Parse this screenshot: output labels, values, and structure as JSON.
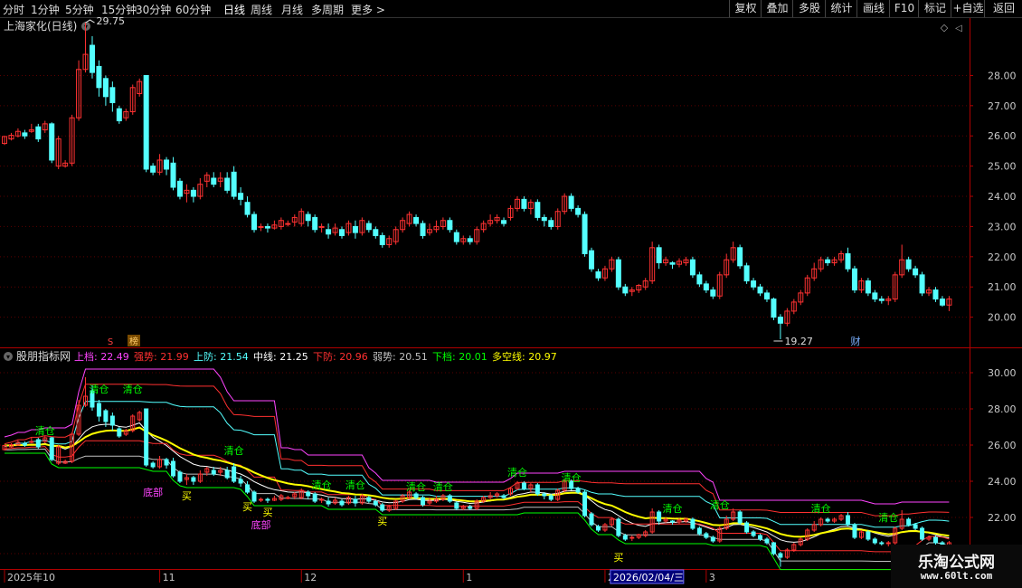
{
  "toolbar": {
    "periods": [
      "分时",
      "1分钟",
      "5分钟",
      "15分钟",
      "30分钟",
      "60分钟",
      "日线",
      "周线",
      "月线",
      "多周期",
      "更多"
    ],
    "more_arrow": ">",
    "buttons": [
      "复权",
      "叠加",
      "多股",
      "统计",
      "画线",
      "F10",
      "标记",
      "+自选",
      "返回"
    ]
  },
  "colors": {
    "up": "#ff3232",
    "down": "#54ffff",
    "axis": "#b00000",
    "upper": "#ff44ff",
    "strong": "#ff3030",
    "upper_def": "#54ffff",
    "mid": "#ffffff",
    "lower_def": "#ff3030",
    "weak": "#c0c0c0",
    "lower": "#00ff00",
    "bullbear": "#ffff00",
    "qingcang": "#00ff00",
    "dibu": "#ff44ff",
    "mai": "#ffff00"
  },
  "chart_data": {
    "type": "candlestick",
    "title": "上海家化(日线)",
    "main_yticks": [
      "20.00",
      "21.00",
      "22.00",
      "23.00",
      "24.00",
      "25.00",
      "26.00",
      "27.00",
      "28.00"
    ],
    "main_ylim": [
      19.0,
      29.9
    ],
    "max_label": "29.75",
    "min_label": "19.27",
    "markers": {
      "s": "S",
      "bang": "榜",
      "cai": "财"
    },
    "candles": [
      [
        25.75,
        25.98,
        26.0,
        25.7
      ],
      [
        25.9,
        26.02,
        26.1,
        25.85
      ],
      [
        26.0,
        26.15,
        26.25,
        25.95
      ],
      [
        26.1,
        26.0,
        26.2,
        25.9
      ],
      [
        26.15,
        26.2,
        26.4,
        26.1
      ],
      [
        26.3,
        25.9,
        26.4,
        25.8
      ],
      [
        26.2,
        26.4,
        26.5,
        26.1
      ],
      [
        26.4,
        25.2,
        26.45,
        25.1
      ],
      [
        25.0,
        25.9,
        26.0,
        24.9
      ],
      [
        25.0,
        25.1,
        25.2,
        24.95
      ],
      [
        25.1,
        26.6,
        26.7,
        25.0
      ],
      [
        26.6,
        28.2,
        28.5,
        26.5
      ],
      [
        28.2,
        28.7,
        29.75,
        28.1
      ],
      [
        29.0,
        28.1,
        29.3,
        27.9
      ],
      [
        28.3,
        27.6,
        28.5,
        27.3
      ],
      [
        27.9,
        27.3,
        28.0,
        27.0
      ],
      [
        27.6,
        27.1,
        27.8,
        26.8
      ],
      [
        26.9,
        26.5,
        27.0,
        26.4
      ],
      [
        26.6,
        26.8,
        26.9,
        26.5
      ],
      [
        26.8,
        27.6,
        27.7,
        26.7
      ],
      [
        27.4,
        27.8,
        27.9,
        27.3
      ],
      [
        28.0,
        24.9,
        28.0,
        24.8
      ],
      [
        25.0,
        24.8,
        25.1,
        24.7
      ],
      [
        24.8,
        25.2,
        25.4,
        24.7
      ],
      [
        25.2,
        24.9,
        25.3,
        24.7
      ],
      [
        25.1,
        24.3,
        25.3,
        24.2
      ],
      [
        24.5,
        24.0,
        24.6,
        23.9
      ],
      [
        24.1,
        24.2,
        24.4,
        23.8
      ],
      [
        24.2,
        24.0,
        24.3,
        23.8
      ],
      [
        24.0,
        24.4,
        24.6,
        23.9
      ],
      [
        24.5,
        24.7,
        24.8,
        24.3
      ],
      [
        24.6,
        24.4,
        24.8,
        24.3
      ],
      [
        24.5,
        24.6,
        24.8,
        24.3
      ],
      [
        24.6,
        24.2,
        24.8,
        24.1
      ],
      [
        24.8,
        24.0,
        25.0,
        23.9
      ],
      [
        24.1,
        23.9,
        24.3,
        23.7
      ],
      [
        23.8,
        23.4,
        24.0,
        23.3
      ],
      [
        23.4,
        22.9,
        23.5,
        22.8
      ],
      [
        23.0,
        23.0,
        23.1,
        22.85
      ],
      [
        23.0,
        22.95,
        23.1,
        22.8
      ],
      [
        22.95,
        23.05,
        23.2,
        22.9
      ],
      [
        23.0,
        23.2,
        23.3,
        22.9
      ],
      [
        23.1,
        23.1,
        23.2,
        23.0
      ],
      [
        23.15,
        23.3,
        23.4,
        23.0
      ],
      [
        23.1,
        23.5,
        23.6,
        23.0
      ],
      [
        23.4,
        23.2,
        23.5,
        23.0
      ],
      [
        23.3,
        22.9,
        23.4,
        22.8
      ],
      [
        23.0,
        23.0,
        23.1,
        22.8
      ],
      [
        22.9,
        22.75,
        23.1,
        22.6
      ],
      [
        22.8,
        22.95,
        23.1,
        22.7
      ],
      [
        22.9,
        22.7,
        23.0,
        22.6
      ],
      [
        22.8,
        23.1,
        23.2,
        22.7
      ],
      [
        23.0,
        22.8,
        23.2,
        22.6
      ],
      [
        22.8,
        23.2,
        23.3,
        22.7
      ],
      [
        23.1,
        22.9,
        23.2,
        22.8
      ],
      [
        22.9,
        22.7,
        23.0,
        22.6
      ],
      [
        22.7,
        22.4,
        22.8,
        22.3
      ],
      [
        22.4,
        22.6,
        22.7,
        22.3
      ],
      [
        22.5,
        22.9,
        23.0,
        22.4
      ],
      [
        22.9,
        23.2,
        23.3,
        22.8
      ],
      [
        23.1,
        23.4,
        23.5,
        23.0
      ],
      [
        23.3,
        23.1,
        23.4,
        23.0
      ],
      [
        23.1,
        22.7,
        23.2,
        22.6
      ],
      [
        22.8,
        22.9,
        23.1,
        22.7
      ],
      [
        22.9,
        23.0,
        23.2,
        22.8
      ],
      [
        23.0,
        23.2,
        23.3,
        22.9
      ],
      [
        23.2,
        22.9,
        23.3,
        22.8
      ],
      [
        22.8,
        22.5,
        22.9,
        22.4
      ],
      [
        22.5,
        22.6,
        22.7,
        22.4
      ],
      [
        22.6,
        22.5,
        22.7,
        22.4
      ],
      [
        22.5,
        22.9,
        23.0,
        22.4
      ],
      [
        22.9,
        23.1,
        23.2,
        22.8
      ],
      [
        23.1,
        23.2,
        23.4,
        23.0
      ],
      [
        23.2,
        23.3,
        23.4,
        23.1
      ],
      [
        23.2,
        23.1,
        23.3,
        23.0
      ],
      [
        23.3,
        23.6,
        23.7,
        23.2
      ],
      [
        23.6,
        23.9,
        24.0,
        23.5
      ],
      [
        23.9,
        23.6,
        24.0,
        23.5
      ],
      [
        23.6,
        23.8,
        23.9,
        23.4
      ],
      [
        23.8,
        23.3,
        23.9,
        23.2
      ],
      [
        23.3,
        23.2,
        23.4,
        23.0
      ],
      [
        23.2,
        23.0,
        23.3,
        22.9
      ],
      [
        23.0,
        23.5,
        23.6,
        22.9
      ],
      [
        23.5,
        24.0,
        24.1,
        23.4
      ],
      [
        24.0,
        23.6,
        24.1,
        23.5
      ],
      [
        23.6,
        23.4,
        23.7,
        23.3
      ],
      [
        23.4,
        22.1,
        23.5,
        22.0
      ],
      [
        22.2,
        21.6,
        22.3,
        21.5
      ],
      [
        21.5,
        21.3,
        21.6,
        21.2
      ],
      [
        21.3,
        21.6,
        21.7,
        21.2
      ],
      [
        21.6,
        21.9,
        22.0,
        21.5
      ],
      [
        21.9,
        21.0,
        22.0,
        20.9
      ],
      [
        21.0,
        20.8,
        21.1,
        20.7
      ],
      [
        20.85,
        20.9,
        21.0,
        20.7
      ],
      [
        20.9,
        21.05,
        21.1,
        20.8
      ],
      [
        21.0,
        21.2,
        21.3,
        20.9
      ],
      [
        21.2,
        22.3,
        22.5,
        21.1
      ],
      [
        22.3,
        21.8,
        22.4,
        21.6
      ],
      [
        21.8,
        21.9,
        22.0,
        21.7
      ],
      [
        21.8,
        21.75,
        21.85,
        21.6
      ],
      [
        21.75,
        21.85,
        21.95,
        21.65
      ],
      [
        21.8,
        21.9,
        22.0,
        21.7
      ],
      [
        21.9,
        21.4,
        22.0,
        21.3
      ],
      [
        21.4,
        21.1,
        21.5,
        21.0
      ],
      [
        21.1,
        20.9,
        21.2,
        20.8
      ],
      [
        20.9,
        20.7,
        21.0,
        20.6
      ],
      [
        20.7,
        21.4,
        21.5,
        20.6
      ],
      [
        21.4,
        21.9,
        22.1,
        21.3
      ],
      [
        21.9,
        22.3,
        22.5,
        21.8
      ],
      [
        22.3,
        21.7,
        22.4,
        21.6
      ],
      [
        21.7,
        21.2,
        21.8,
        21.1
      ],
      [
        21.2,
        21.0,
        21.3,
        20.9
      ],
      [
        21.0,
        20.8,
        21.1,
        20.7
      ],
      [
        20.8,
        20.6,
        20.9,
        20.5
      ],
      [
        20.6,
        20.0,
        20.65,
        19.9
      ],
      [
        20.0,
        19.8,
        20.1,
        19.27
      ],
      [
        19.8,
        20.2,
        20.3,
        19.7
      ],
      [
        20.2,
        20.5,
        20.6,
        20.1
      ],
      [
        20.5,
        20.8,
        20.9,
        20.4
      ],
      [
        20.8,
        21.3,
        21.4,
        20.7
      ],
      [
        21.3,
        21.6,
        21.8,
        21.2
      ],
      [
        21.6,
        21.9,
        22.0,
        21.5
      ],
      [
        21.9,
        21.8,
        22.0,
        21.7
      ],
      [
        21.8,
        21.9,
        22.0,
        21.7
      ],
      [
        21.9,
        22.1,
        22.2,
        21.8
      ],
      [
        22.1,
        21.6,
        22.3,
        21.5
      ],
      [
        21.6,
        20.9,
        21.7,
        20.8
      ],
      [
        20.9,
        21.2,
        21.3,
        20.8
      ],
      [
        21.2,
        20.8,
        21.3,
        20.7
      ],
      [
        20.8,
        20.6,
        20.9,
        20.5
      ],
      [
        20.6,
        20.55,
        20.7,
        20.45
      ],
      [
        20.55,
        20.6,
        20.7,
        20.4
      ],
      [
        20.6,
        21.4,
        21.5,
        20.5
      ],
      [
        21.4,
        21.9,
        22.4,
        21.3
      ],
      [
        21.9,
        21.6,
        22.0,
        21.5
      ],
      [
        21.6,
        21.4,
        21.7,
        21.3
      ],
      [
        21.4,
        20.8,
        21.5,
        20.7
      ],
      [
        20.8,
        20.9,
        21.0,
        20.7
      ],
      [
        20.9,
        20.6,
        21.0,
        20.5
      ],
      [
        20.6,
        20.4,
        20.7,
        20.35
      ],
      [
        20.4,
        20.6,
        20.7,
        20.2
      ]
    ],
    "indicator": {
      "title": "股朋指标网",
      "values": [
        {
          "label": "上档: 22.49",
          "key": "upper"
        },
        {
          "label": "强势: 21.99",
          "key": "strong"
        },
        {
          "label": "上防: 21.54",
          "key": "upper_def"
        },
        {
          "label": "中线: 21.25",
          "key": "mid"
        },
        {
          "label": "下防: 20.96",
          "key": "lower_def"
        },
        {
          "label": "弱势: 20.51",
          "key": "weak"
        },
        {
          "label": "下档: 20.01",
          "key": "lower"
        },
        {
          "label": "多空线: 20.97",
          "key": "bullbear"
        }
      ],
      "yticks": [
        "20.00",
        "22.00",
        "24.00",
        "26.00",
        "28.00",
        "30.00"
      ],
      "ylim": [
        19.2,
        31.3
      ],
      "signals": [
        {
          "text": "清仓",
          "i": 6,
          "y": 26.8,
          "kind": "qingcang"
        },
        {
          "text": "清仓",
          "i": 14,
          "y": 29.1,
          "kind": "qingcang"
        },
        {
          "text": "清仓",
          "i": 19,
          "y": 29.1,
          "kind": "qingcang"
        },
        {
          "text": "清仓",
          "i": 34,
          "y": 25.7,
          "kind": "qingcang"
        },
        {
          "text": "清仓",
          "i": 47,
          "y": 23.8,
          "kind": "qingcang"
        },
        {
          "text": "清仓",
          "i": 52,
          "y": 23.8,
          "kind": "qingcang"
        },
        {
          "text": "清仓",
          "i": 61,
          "y": 23.7,
          "kind": "qingcang"
        },
        {
          "text": "清仓",
          "i": 65,
          "y": 23.7,
          "kind": "qingcang"
        },
        {
          "text": "清仓",
          "i": 76,
          "y": 24.5,
          "kind": "qingcang"
        },
        {
          "text": "清仓",
          "i": 84,
          "y": 24.2,
          "kind": "qingcang"
        },
        {
          "text": "清仓",
          "i": 99,
          "y": 22.5,
          "kind": "qingcang"
        },
        {
          "text": "清仓",
          "i": 106,
          "y": 22.7,
          "kind": "qingcang"
        },
        {
          "text": "清仓",
          "i": 121,
          "y": 22.5,
          "kind": "qingcang"
        },
        {
          "text": "清仓",
          "i": 131,
          "y": 22.0,
          "kind": "qingcang"
        },
        {
          "text": "底部",
          "i": 22,
          "y": 23.4,
          "kind": "dibu"
        },
        {
          "text": "底部",
          "i": 38,
          "y": 21.6,
          "kind": "dibu"
        },
        {
          "text": "买",
          "i": 27,
          "y": 23.2,
          "kind": "mai"
        },
        {
          "text": "买",
          "i": 36,
          "y": 22.6,
          "kind": "mai"
        },
        {
          "text": "买",
          "i": 39,
          "y": 22.3,
          "kind": "mai"
        },
        {
          "text": "买",
          "i": 56,
          "y": 21.8,
          "kind": "mai"
        },
        {
          "text": "买",
          "i": 91,
          "y": 19.8,
          "kind": "mai"
        }
      ]
    },
    "xaxis": {
      "labels": [
        {
          "text": "2025年10",
          "i": 0
        },
        {
          "text": "11",
          "i": 23
        },
        {
          "text": "12",
          "i": 44
        },
        {
          "text": "1",
          "i": 68
        },
        {
          "text": "2",
          "i": 89
        },
        {
          "text": "3",
          "i": 104
        }
      ],
      "highlight": {
        "text": "2026/02/04/三",
        "i": 91
      }
    }
  },
  "logo": {
    "line1": "乐淘公式网",
    "line2": "www.60lt.com"
  }
}
